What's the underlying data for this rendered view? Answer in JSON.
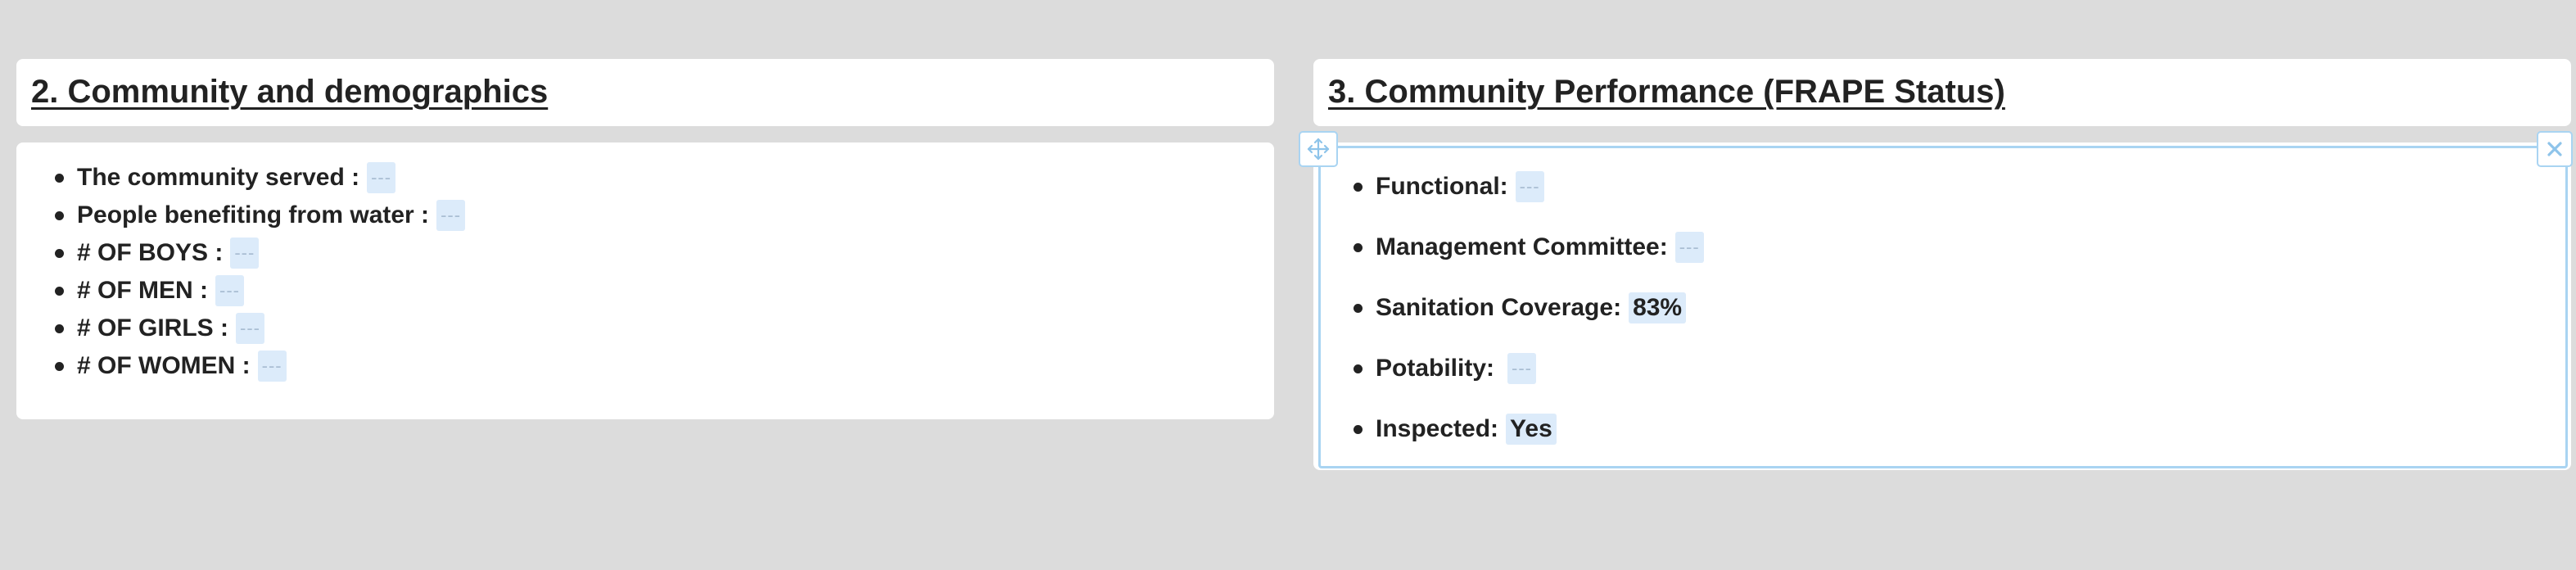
{
  "left_panel": {
    "title": "2. Community and demographics",
    "items": [
      {
        "label": "The community served :",
        "value": "---"
      },
      {
        "label": "People benefiting from water :",
        "value": "---"
      },
      {
        "label": "# OF BOYS :",
        "value": "---"
      },
      {
        "label": "# OF MEN :",
        "value": "---"
      },
      {
        "label": "# OF GIRLS :",
        "value": "---"
      },
      {
        "label": "# OF WOMEN :",
        "value": "---"
      }
    ]
  },
  "right_panel": {
    "title": "3. Community Performance (FRAPE Status)",
    "items": [
      {
        "label": "Functional:",
        "value": "---"
      },
      {
        "label": "Management Committee:",
        "value": "---"
      },
      {
        "label": "Sanitation Coverage:",
        "value": "83%"
      },
      {
        "label": "Potability:",
        "value": "---"
      },
      {
        "label": "Inspected:",
        "value": "Yes"
      }
    ]
  },
  "icons": {
    "move": "move-arrows-icon",
    "close": "close-x-icon"
  },
  "colors": {
    "background": "#dcdcdc",
    "panel": "#ffffff",
    "value_highlight": "#dcebfa",
    "selection_border": "#a9d4f2"
  }
}
